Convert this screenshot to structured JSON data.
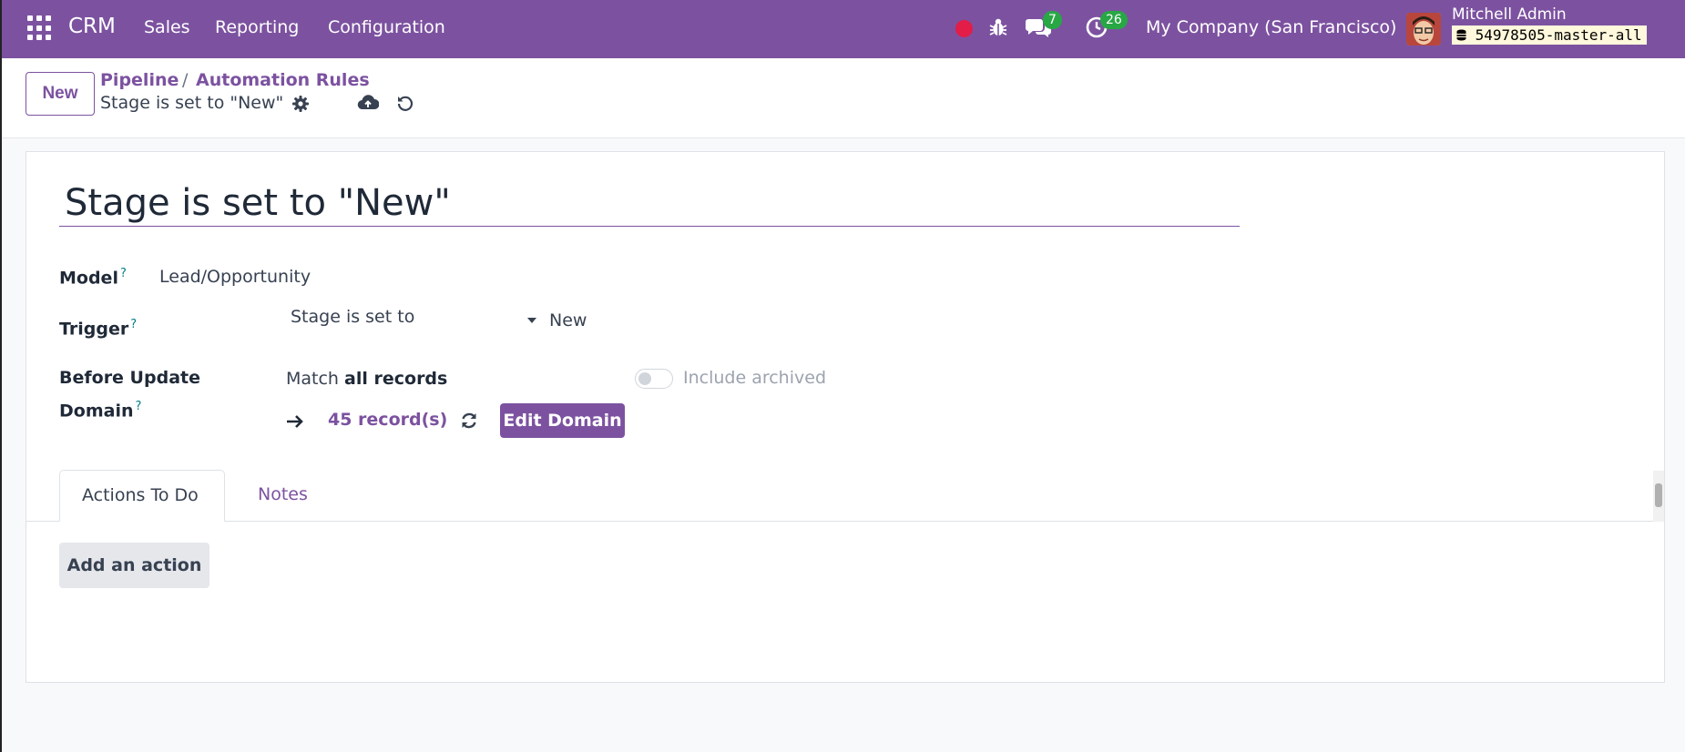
{
  "navbar": {
    "brand": "CRM",
    "menu": [
      "Sales",
      "Reporting",
      "Configuration"
    ],
    "messages_count": "7",
    "activities_count": "26",
    "company": "My Company (San Francisco)",
    "user_name": "Mitchell Admin",
    "database": "54978505-master-all"
  },
  "control_panel": {
    "new_label": "New",
    "breadcrumb_root": "Pipeline",
    "breadcrumb_separator": "/",
    "breadcrumb_parent": "Automation Rules",
    "breadcrumb_current": "Stage is set to \"New\""
  },
  "form": {
    "title": "Stage is set to \"New\"",
    "model_label": "Model",
    "model_value": "Lead/Opportunity",
    "trigger_label": "Trigger",
    "trigger_value": "Stage is set to",
    "trigger_stage": "New",
    "domain_label_1": "Before Update",
    "domain_label_2": "Domain",
    "help_mark": "?",
    "match_prefix": "Match",
    "match_value": "all records",
    "include_archived": "Include archived",
    "include_archived_on": false,
    "records_count": "45 record(s)",
    "edit_domain_label": "Edit Domain"
  },
  "tabs": {
    "actions_label": "Actions To Do",
    "notes_label": "Notes",
    "active": "Actions To Do"
  },
  "actions": {
    "add_action_label": "Add an action"
  },
  "colors": {
    "brand": "#7c52a0",
    "badge": "#28a745",
    "record_dot": "#e11d48",
    "help": "#017e84"
  }
}
